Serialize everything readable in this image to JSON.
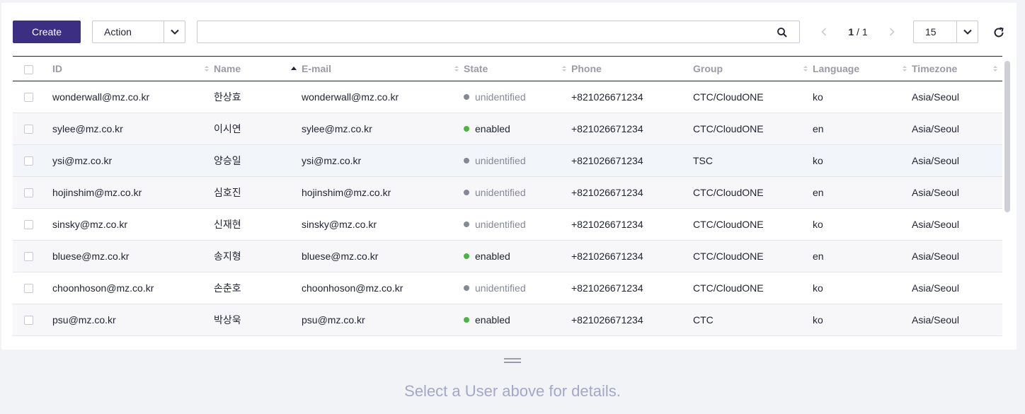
{
  "toolbar": {
    "create_label": "Create",
    "action_label": "Action",
    "search_placeholder": "",
    "search_value": "",
    "page_current": "1",
    "page_total": " / 1",
    "page_size": "15"
  },
  "colors": {
    "primary": "#3b2e83",
    "enabled": "#46b83f",
    "unidentified": "#858895"
  },
  "columns": [
    "ID",
    "Name",
    "E-mail",
    "State",
    "Phone",
    "Group",
    "Language",
    "Timezone"
  ],
  "rows": [
    {
      "id": "wonderwall@mz.co.kr",
      "name": "한상효",
      "email": "wonderwall@mz.co.kr",
      "state": "unidentified",
      "phone": "+821026671234",
      "group": "CTC/CloudONE",
      "language": "ko",
      "timezone": "Asia/Seoul"
    },
    {
      "id": "sylee@mz.co.kr",
      "name": "이시연",
      "email": "sylee@mz.co.kr",
      "state": "enabled",
      "phone": "+821026671234",
      "group": "CTC/CloudONE",
      "language": "en",
      "timezone": "Asia/Seoul"
    },
    {
      "id": "ysi@mz.co.kr",
      "name": "양승일",
      "email": "ysi@mz.co.kr",
      "state": "unidentified",
      "phone": "+821026671234",
      "group": "TSC",
      "language": "ko",
      "timezone": "Asia/Seoul"
    },
    {
      "id": "hojinshim@mz.co.kr",
      "name": "심호진",
      "email": "hojinshim@mz.co.kr",
      "state": "unidentified",
      "phone": "+821026671234",
      "group": "CTC/CloudONE",
      "language": "en",
      "timezone": "Asia/Seoul"
    },
    {
      "id": "sinsky@mz.co.kr",
      "name": "신재현",
      "email": "sinsky@mz.co.kr",
      "state": "unidentified",
      "phone": "+821026671234",
      "group": "CTC/CloudONE",
      "language": "ko",
      "timezone": "Asia/Seoul"
    },
    {
      "id": "bluese@mz.co.kr",
      "name": "송지형",
      "email": "bluese@mz.co.kr",
      "state": "enabled",
      "phone": "+821026671234",
      "group": "CTC/CloudONE",
      "language": "en",
      "timezone": "Asia/Seoul"
    },
    {
      "id": "choonhoson@mz.co.kr",
      "name": "손춘호",
      "email": "choonhoson@mz.co.kr",
      "state": "unidentified",
      "phone": "+821026671234",
      "group": "CTC/CloudONE",
      "language": "ko",
      "timezone": "Asia/Seoul"
    },
    {
      "id": "psu@mz.co.kr",
      "name": "박상욱",
      "email": "psu@mz.co.kr",
      "state": "enabled",
      "phone": "+821026671234",
      "group": "CTC",
      "language": "ko",
      "timezone": "Asia/Seoul"
    }
  ],
  "empty_message": "Select a User above for details."
}
